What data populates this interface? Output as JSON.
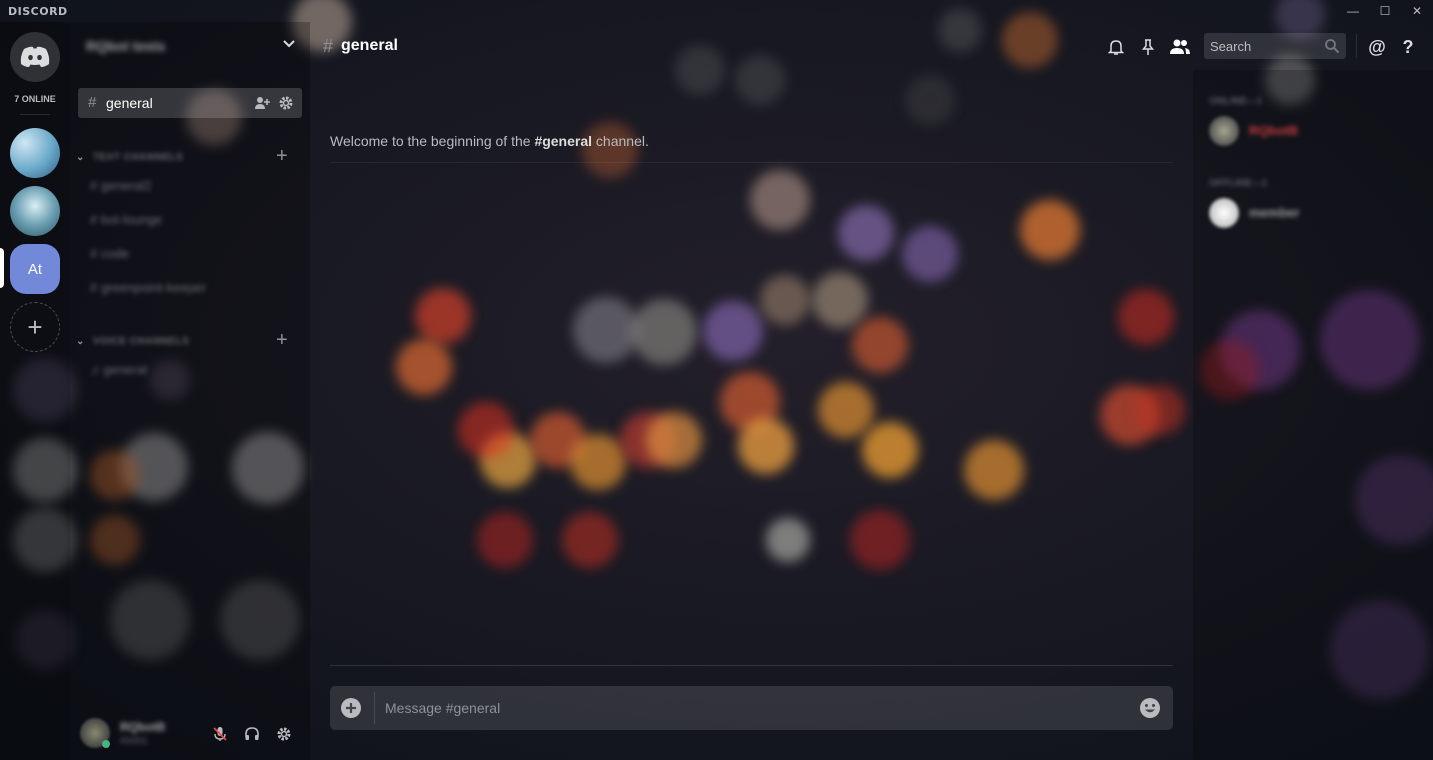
{
  "app": {
    "brand": "DISCORD"
  },
  "window_controls": [
    "minimize-icon",
    "maximize-icon",
    "close-icon"
  ],
  "guilds": {
    "online_count": "7 ONLINE",
    "servers": [
      {
        "name": "server-1",
        "type": "image"
      },
      {
        "name": "server-2",
        "type": "image"
      },
      {
        "initials": "At",
        "selected": true
      }
    ],
    "add_server_icon": "plus-icon"
  },
  "sidebar": {
    "server_name": "RQbot tests",
    "selected_channel": {
      "hash": "#",
      "name": "general"
    },
    "categories": [
      {
        "label": "TEXT CHANNELS",
        "channels": [
          "general2",
          "bot-lounge",
          "code",
          "greenpoint-keeper"
        ]
      },
      {
        "label": "VOICE CHANNELS",
        "channels": [
          "general"
        ]
      }
    ],
    "user": {
      "name": "RQbotB",
      "tag": "#0001"
    }
  },
  "header": {
    "hash": "#",
    "channel_name": "general",
    "search_placeholder": "Search"
  },
  "main": {
    "welcome_prefix": "Welcome to the beginning of the ",
    "welcome_channel": "#general",
    "welcome_suffix": " channel."
  },
  "composer": {
    "placeholder": "Message #general"
  },
  "members": {
    "groups": [
      {
        "label": "ONLINE—1",
        "members": [
          {
            "name": "RQbotB",
            "color": "#f04747"
          }
        ]
      },
      {
        "label": "OFFLINE—1",
        "members": [
          {
            "name": "member",
            "color": "#b9bbbe"
          }
        ]
      }
    ]
  },
  "colors": {
    "accent": "#7289da",
    "online": "#43b581",
    "role_red": "#f04747"
  }
}
